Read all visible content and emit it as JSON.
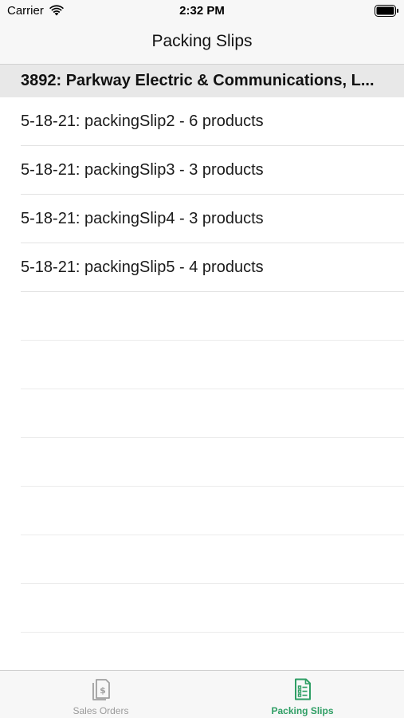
{
  "status_bar": {
    "carrier": "Carrier",
    "time": "2:32 PM"
  },
  "nav": {
    "title": "Packing Slips"
  },
  "section": {
    "title": "3892: Parkway Electric & Communications, L..."
  },
  "packing_slips": [
    {
      "label": "5-18-21: packingSlip2 - 6 products"
    },
    {
      "label": "5-18-21: packingSlip3 - 3 products"
    },
    {
      "label": "5-18-21: packingSlip4 - 3 products"
    },
    {
      "label": "5-18-21: packingSlip5 - 4 products"
    }
  ],
  "tab_bar": {
    "tabs": [
      {
        "label": "Sales Orders",
        "icon": "sales-orders-icon",
        "selected": false
      },
      {
        "label": "Packing Slips",
        "icon": "packing-slips-icon",
        "selected": true
      }
    ]
  },
  "colors": {
    "accent": "#2e9e64",
    "inactive": "#9a9a9a"
  }
}
